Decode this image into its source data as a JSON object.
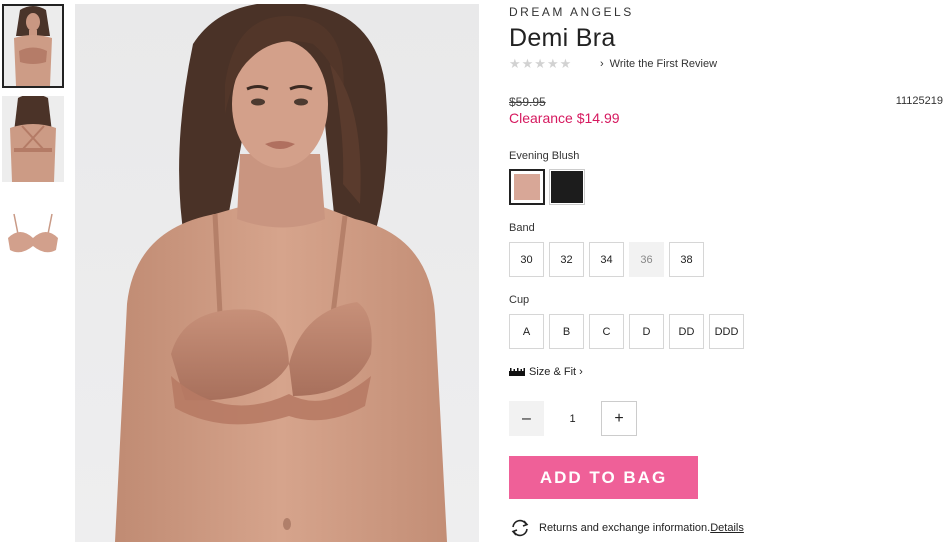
{
  "brand": "DREAM ANGELS",
  "title": "Demi Bra",
  "rating": {
    "stars": "★★★★★",
    "stars_filled": 0,
    "stars_total": 5,
    "review_link": "Write the First Review"
  },
  "price": {
    "original": "$59.95",
    "sale": "Clearance $14.99",
    "sale_color": "#d6195f"
  },
  "sku": "11125219",
  "color": {
    "selected_label": "Evening Blush",
    "swatches": [
      {
        "name": "Evening Blush",
        "hex": "#d8a797",
        "selected": true
      },
      {
        "name": "Black",
        "hex": "#1c1c1c",
        "selected": false
      }
    ]
  },
  "band": {
    "label": "Band",
    "options": [
      {
        "value": "30",
        "available": true
      },
      {
        "value": "32",
        "available": true
      },
      {
        "value": "34",
        "available": true
      },
      {
        "value": "36",
        "available": false
      },
      {
        "value": "38",
        "available": true
      }
    ]
  },
  "cup": {
    "label": "Cup",
    "options": [
      {
        "value": "A",
        "available": true
      },
      {
        "value": "B",
        "available": true
      },
      {
        "value": "C",
        "available": true
      },
      {
        "value": "D",
        "available": true
      },
      {
        "value": "DD",
        "available": true
      },
      {
        "value": "DDD",
        "available": true
      }
    ]
  },
  "size_fit": {
    "label": "Size & Fit",
    "icon": "ruler-icon"
  },
  "quantity": {
    "minus": "–",
    "value": "1",
    "plus": "+"
  },
  "cta": {
    "add_to_bag": "ADD TO BAG",
    "color": "#ef6098"
  },
  "returns": {
    "text": "Returns and exchange information.",
    "link": "Details",
    "icon": "exchange-icon"
  },
  "images": {
    "thumbnails": [
      "front",
      "back",
      "flat"
    ],
    "selected_index": 0
  }
}
